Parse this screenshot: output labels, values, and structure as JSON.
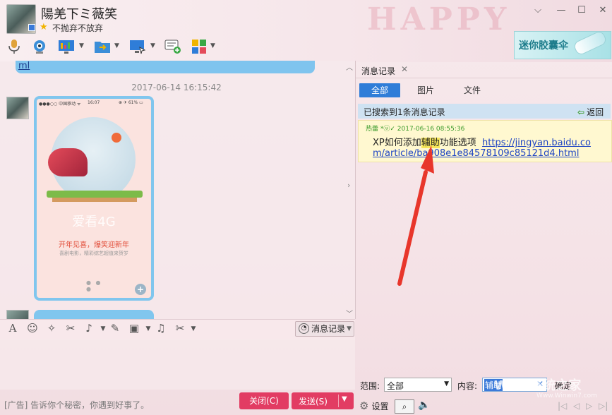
{
  "header": {
    "nickname": "陽羌下ミ薇笑",
    "signature": "不抛弃不放弃",
    "background_text": "HAPPY",
    "ad_banner_text": "迷你胶囊伞",
    "window_buttons": [
      "chevron-down-icon",
      "minimize-icon",
      "maximize-icon",
      "close-icon"
    ],
    "tools": [
      "microphone-icon",
      "video-camera-icon",
      "screen-share-icon",
      "file-transfer-icon",
      "remote-desktop-icon",
      "message-plus-icon",
      "apps-grid-icon"
    ]
  },
  "chat": {
    "prev_message_link": "ml",
    "timestamp": "2017-06-14 16:15:42",
    "phone_status": {
      "carrier": "●●●○○ 中国移动 ᯤ",
      "time": "16:07",
      "battery": "⊕ ✈ 61% ▭"
    },
    "phone_brand": "爱看4G",
    "phone_headline": "开年见喜，爆笑迎新年",
    "phone_sub": "喜剧电影，精彩综艺超值来贺岁",
    "phone_dots": "● ● ●"
  },
  "input_toolbar": {
    "tools": [
      "font-icon",
      "emoji-icon",
      "magic-wand-icon",
      "screenshot-icon",
      "voice-message-icon",
      "edit-icon",
      "image-icon",
      "music-icon",
      "scissors-icon"
    ],
    "history_button": "消息记录"
  },
  "footer": {
    "ad_line": "[广告] 告诉你个秘密，你遇到好事了。",
    "close_label": "关闭(C)",
    "send_label": "发送(S)"
  },
  "history": {
    "tab_label": "消息记录",
    "filters": {
      "all": "全部",
      "images": "图片",
      "files": "文件"
    },
    "result_summary": "已搜索到1条消息记录",
    "back_label": "返回",
    "result": {
      "sender_time": "热蕾 *ⓤ✓ 2017-06-16 08:55:36",
      "text_before": "XP如何添加",
      "highlight": "辅助",
      "text_after": "功能选项",
      "link_line1": "https://jingyan.baidu.co",
      "link_line2": "m/article/ba908e1e84578109c85121d4.html"
    },
    "range_label": "范围:",
    "range_value": "全部",
    "content_label": "内容:",
    "content_value": "辅助",
    "confirm_label": "确定",
    "settings_label": "设置"
  },
  "watermark": {
    "main": "Win7系统之家",
    "sub": "Www.Winwin7.com"
  },
  "colors": {
    "accent_blue": "#2f7dd8",
    "send_red": "#e23c63",
    "highlight": "#f6e65a",
    "arrow_red": "#e8362b"
  }
}
